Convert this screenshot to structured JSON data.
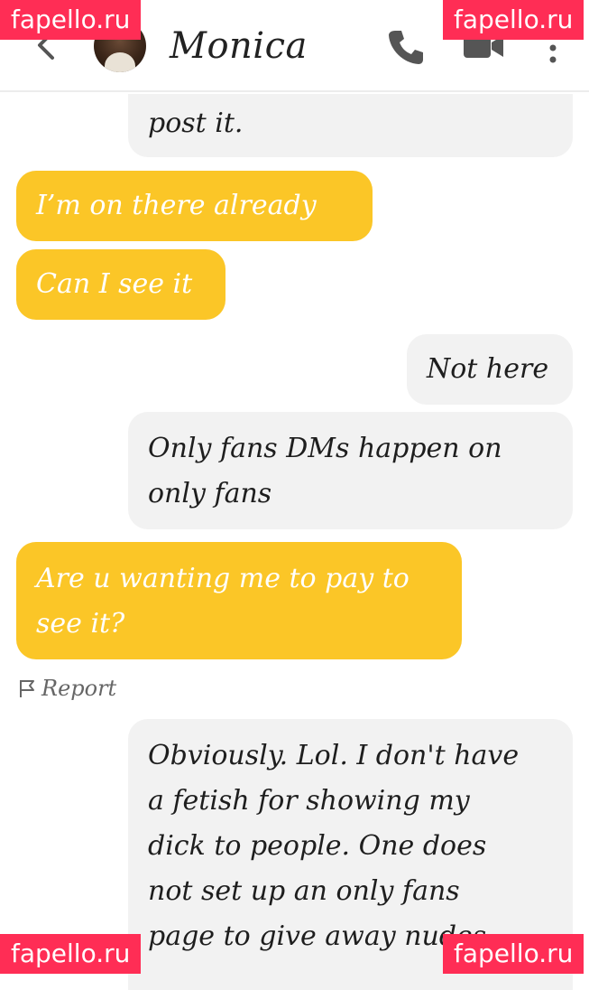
{
  "header": {
    "contact_name": "Monica",
    "back_icon": "chevron-left-icon",
    "call_icon": "phone-icon",
    "video_icon": "video-camera-icon",
    "more_icon": "more-vertical-icon"
  },
  "watermark": "fapello.ru",
  "messages": [
    {
      "direction": "incoming",
      "text": "post it."
    },
    {
      "direction": "outgoing",
      "text": "I’m on there already"
    },
    {
      "direction": "outgoing",
      "text": "Can I see it"
    },
    {
      "direction": "incoming",
      "text": "Not here"
    },
    {
      "direction": "incoming",
      "text": "Only fans DMs happen on\nonly fans"
    },
    {
      "direction": "outgoing",
      "text": "Are u wanting me to pay to\nsee it?"
    },
    {
      "direction": "incoming",
      "text": "Obviously. Lol. I don't have\na fetish for showing my\ndick to people. One does\nnot set up an only fans\npage to give away nudes."
    }
  ],
  "report": {
    "label": "Report",
    "icon": "flag-icon"
  },
  "colors": {
    "outgoing_bubble": "#fbc627",
    "incoming_bubble": "#f2f2f2",
    "watermark_bg": "#ff2d55"
  }
}
